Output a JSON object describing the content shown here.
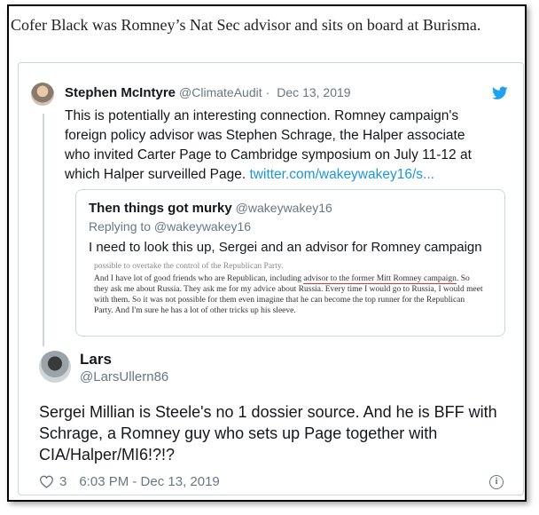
{
  "caption": "Cofer Black was Romney’s Nat Sec advisor and sits on board at Burisma.",
  "parent_tweet": {
    "name": "Stephen McIntyre",
    "handle": "@ClimateAudit",
    "separator": "·",
    "date": "Dec 13, 2019",
    "text": "This is potentially an interesting connection. Romney campaign's foreign policy advisor was Stephen Schrage, the Halper associate who invited Carter Page to Cambridge symposium on July 11-12 at which Halper surveilled Page.",
    "link": "twitter.com/wakeywakey16/s..."
  },
  "quoted_tweet": {
    "name": "Then things got murky",
    "handle": "@wakeywakey16",
    "reply_to": "Replying to @wakeywakey16",
    "text": "I need to look this up, Sergei and an advisor for Romney campaign",
    "image_text": {
      "cut_line": "possible to overtake the control of the Republican Party.",
      "p1": "And I have lot of good friends who are Republican, including",
      "p1_underlined": "advisor to the former Mitt Romney campaign",
      "p2": ". So they ask me about Russia. They ask me for my advice about Russia. Every time I would go to Russia, I would meet with them. So it was not possible for them even imagine that he can become the top runner for the Republican Party. And I'm sure he has a lot of other tricks up his sleeve."
    }
  },
  "main_tweet": {
    "name": "Lars",
    "handle": "@LarsUllern86",
    "text": "Sergei Millian is Steele's no 1 dossier source. And he is BFF with Schrage, a Romney guy who sets up Page together with CIA/Halper/MI6!?!?",
    "likes": "3",
    "time": "6:03 PM - Dec 13, 2019"
  },
  "colors": {
    "link": "#1b95e0",
    "muted": "#657786",
    "border": "#ccd6dd"
  }
}
